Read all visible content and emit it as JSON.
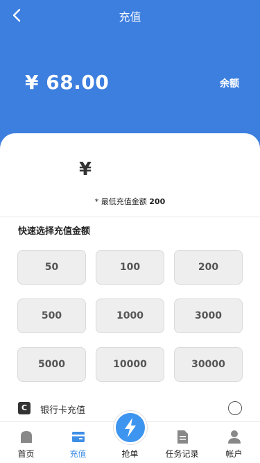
{
  "header": {
    "title": "充值",
    "balance_amount": "¥ 68.00",
    "balance_label": "余额"
  },
  "recharge": {
    "currency_symbol": "¥",
    "min_prefix": "* 最低充值金额",
    "min_amount": "200"
  },
  "quick_select": {
    "title": "快速选择充值金额",
    "amounts": [
      "50",
      "100",
      "200",
      "500",
      "1000",
      "3000",
      "5000",
      "10000",
      "30000"
    ]
  },
  "payment": {
    "method_label": "银行卡充值"
  },
  "tabbar": {
    "items": [
      {
        "label": "首页",
        "icon": "home-icon"
      },
      {
        "label": "充值",
        "icon": "wallet-icon"
      },
      {
        "label": "抢单",
        "icon": "lightning-icon"
      },
      {
        "label": "任务记录",
        "icon": "document-icon"
      },
      {
        "label": "帐户",
        "icon": "user-icon"
      }
    ]
  },
  "colors": {
    "header_bg": "#3d7fdf",
    "active_tab": "#3d8ee6",
    "button_bg": "#eeeeee"
  }
}
